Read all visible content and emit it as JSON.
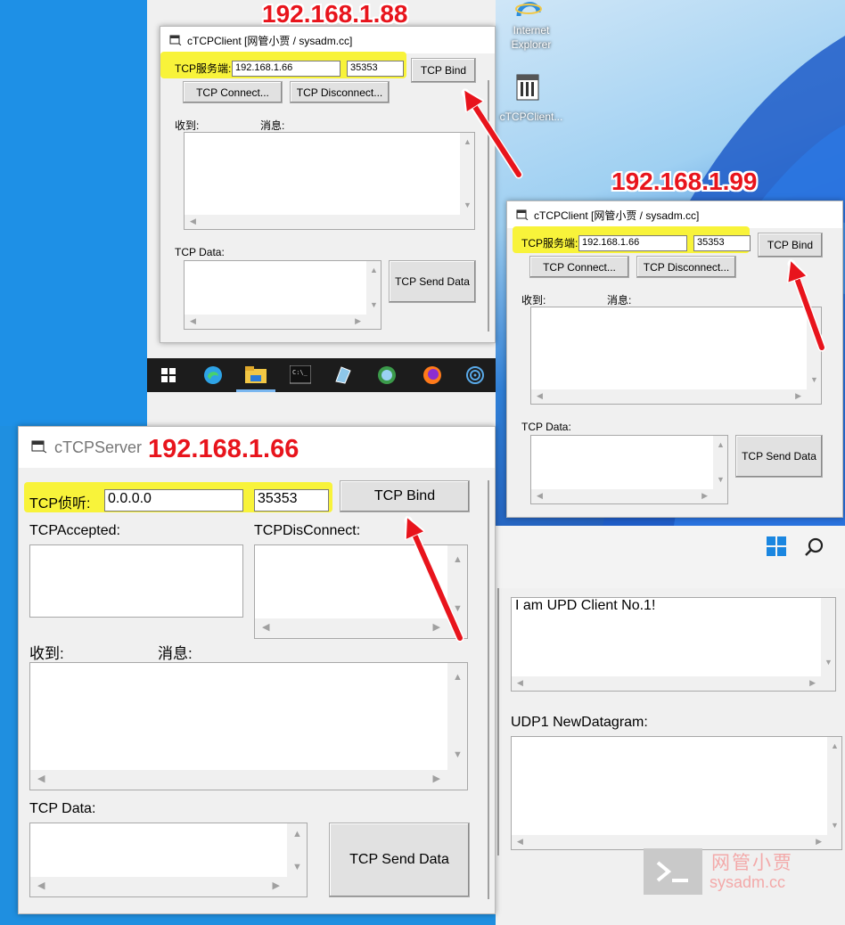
{
  "annotations": {
    "ip_client1": "192.168.1.88",
    "ip_client2": "192.168.1.99",
    "ip_server": "192.168.1.66",
    "arrow_color": "#e8141c",
    "highlight_color": "#f8f33a"
  },
  "desktop": {
    "icons": [
      {
        "label": "Internet\nExplorer"
      },
      {
        "label": "cTCPClient..."
      }
    ]
  },
  "client1": {
    "title": "cTCPClient [网管小贾 / sysadm.cc]",
    "server_label": "TCP服务端:",
    "ip_value": "192.168.1.66",
    "port_value": "35353",
    "bind_button": "TCP Bind",
    "connect_button": "TCP Connect...",
    "disconnect_button": "TCP Disconnect...",
    "received_label": "收到:",
    "message_label": "消息:",
    "data_label": "TCP Data:",
    "send_button": "TCP Send Data"
  },
  "client2": {
    "title": "cTCPClient [网管小贾 / sysadm.cc]",
    "server_label": "TCP服务端:",
    "ip_value": "192.168.1.66",
    "port_value": "35353",
    "bind_button": "TCP Bind",
    "connect_button": "TCP Connect...",
    "disconnect_button": "TCP Disconnect...",
    "received_label": "收到:",
    "message_label": "消息:",
    "data_label": "TCP Data:",
    "send_button": "TCP Send Data"
  },
  "server": {
    "title": "cTCPServer",
    "listen_label": "TCP侦听:",
    "ip_value": "0.0.0.0",
    "port_value": "35353",
    "bind_button": "TCP Bind",
    "accepted_label": "TCPAccepted:",
    "disconnect_label": "TCPDisConnect:",
    "received_label": "收到:",
    "message_label": "消息:",
    "data_label": "TCP Data:",
    "send_button": "TCP Send Data"
  },
  "udp": {
    "message_text": "I am UPD Client No.1!",
    "datagram_label": "UDP1 NewDatagram:"
  },
  "watermark": {
    "cn": "网管小贾",
    "en": "sysadm.cc"
  }
}
